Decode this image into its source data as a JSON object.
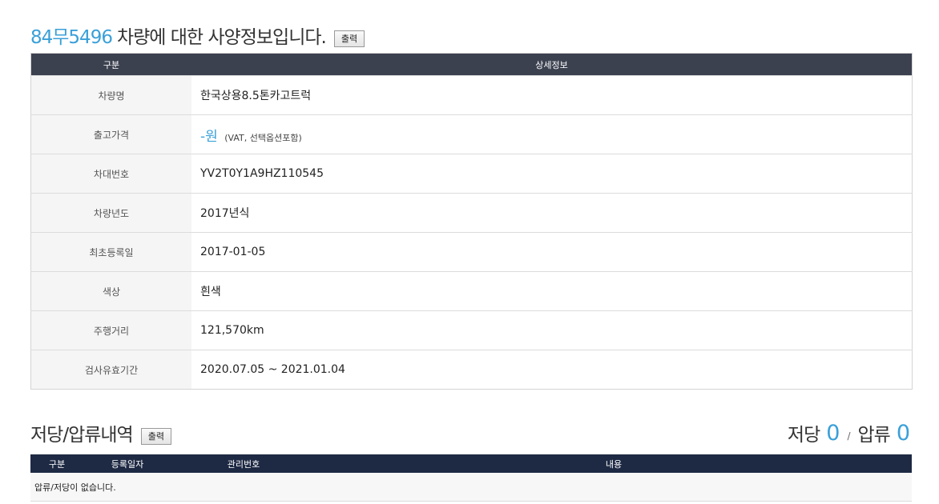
{
  "spec": {
    "plate": "84무5496",
    "title": "차량에 대한 사양정보입니다.",
    "print_label": "출력",
    "col_category": "구분",
    "col_detail": "상세정보",
    "rows": [
      {
        "label": "차량명",
        "value": "한국상용8.5톤카고트럭"
      },
      {
        "label": "출고가격",
        "value": "-원",
        "note": "(VAT, 선택옵션포함)"
      },
      {
        "label": "차대번호",
        "value": "YV2T0Y1A9HZ110545"
      },
      {
        "label": "차량년도",
        "value": "2017년식"
      },
      {
        "label": "최초등록일",
        "value": "2017-01-05"
      },
      {
        "label": "색상",
        "value": "흰색"
      },
      {
        "label": "주행거리",
        "value": "121,570km"
      },
      {
        "label": "검사유효기간",
        "value": "2020.07.05 ~ 2021.01.04"
      }
    ]
  },
  "lien": {
    "title": "저당/압류내역",
    "print_label": "출력",
    "mortgage_label": "저당",
    "mortgage_count": "0",
    "separator": "/",
    "seizure_label": "압류",
    "seizure_count": "0",
    "columns": [
      "구분",
      "등록일자",
      "관리번호",
      "내용"
    ],
    "empty_message": "압류/저당이 없습니다."
  }
}
